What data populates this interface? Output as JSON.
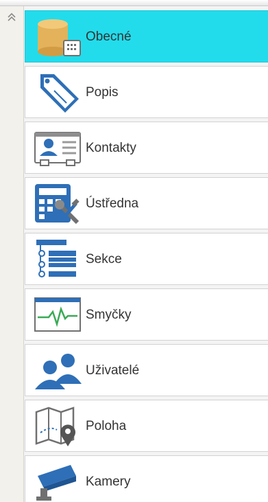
{
  "panel": {
    "collapse_icon": "double-chevron-up-icon",
    "accent_color": "#22dcec",
    "icon_color": "#2e6fb7",
    "items": [
      {
        "label": "Obecné",
        "icon": "database-settings-icon",
        "selected": true
      },
      {
        "label": "Popis",
        "icon": "tag-icon",
        "selected": false
      },
      {
        "label": "Kontakty",
        "icon": "contact-card-icon",
        "selected": false
      },
      {
        "label": "Ústředna",
        "icon": "control-panel-tools-icon",
        "selected": false
      },
      {
        "label": "Sekce",
        "icon": "sections-tree-icon",
        "selected": false
      },
      {
        "label": "Smyčky",
        "icon": "loop-signal-icon",
        "selected": false
      },
      {
        "label": "Uživatelé",
        "icon": "users-icon",
        "selected": false
      },
      {
        "label": "Poloha",
        "icon": "map-location-icon",
        "selected": false
      },
      {
        "label": "Kamery",
        "icon": "camera-icon",
        "selected": false
      }
    ]
  }
}
